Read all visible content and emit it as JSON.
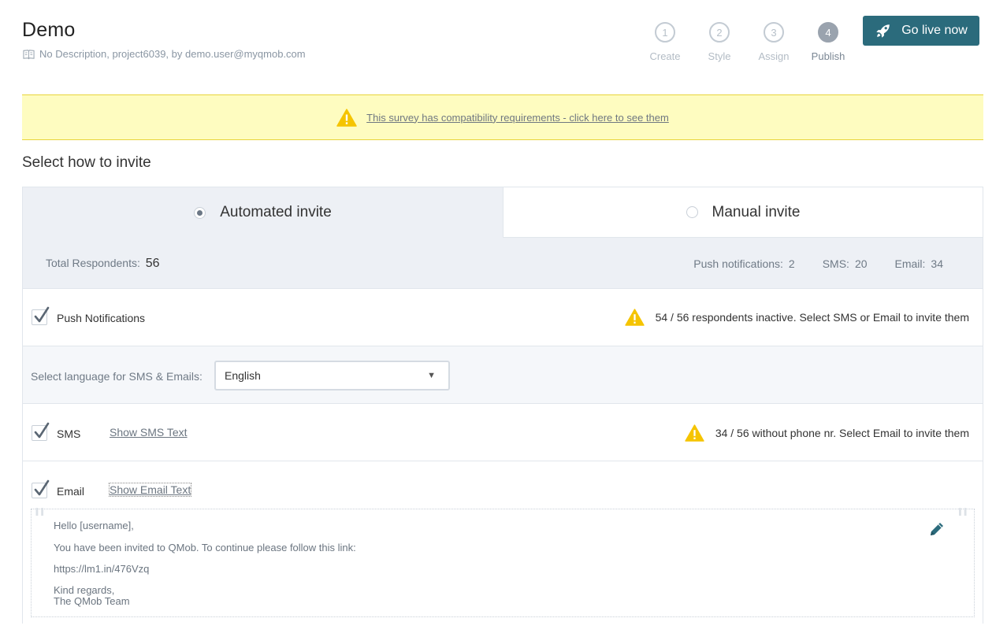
{
  "header": {
    "title": "Demo",
    "subtitle": "No Description, project6039, by demo.user@myqmob.com",
    "go_live_label": "Go live now"
  },
  "steps": [
    {
      "number": "1",
      "label": "Create",
      "active": false
    },
    {
      "number": "2",
      "label": "Style",
      "active": false
    },
    {
      "number": "3",
      "label": "Assign",
      "active": false
    },
    {
      "number": "4",
      "label": "Publish",
      "active": true
    }
  ],
  "banner": {
    "text": "This survey has compatibility requirements - click here to see them"
  },
  "section_title": "Select how to invite",
  "tabs": {
    "automated": "Automated invite",
    "manual": "Manual invite",
    "selected": "automated"
  },
  "stats": {
    "total_label": "Total Respondents:",
    "total_value": "56",
    "push_label": "Push notifications:",
    "push_value": "2",
    "sms_label": "SMS:",
    "sms_value": "20",
    "email_label": "Email:",
    "email_value": "34"
  },
  "push": {
    "label": "Push Notifications",
    "checked": true,
    "warning": "54 / 56 respondents inactive. Select SMS or Email to invite them"
  },
  "language": {
    "label": "Select language for SMS & Emails:",
    "selected": "English"
  },
  "sms": {
    "label": "SMS",
    "checked": true,
    "link": "Show SMS Text",
    "warning": "34 / 56 without phone nr. Select Email to invite them"
  },
  "email": {
    "label": "Email",
    "checked": true,
    "link": "Show Email Text",
    "lines": [
      "Hello [username],",
      "You have been invited to QMob. To continue please follow this link:",
      "https://lm1.in/476Vzq",
      "Kind regards,",
      "The QMob Team"
    ]
  },
  "colors": {
    "accent": "#2b6b7c",
    "warning_bg": "#fefcc0",
    "warning_icon": "#f5c400",
    "panel_bg": "#edf0f5"
  },
  "icons": {
    "subtitle": "book-icon",
    "go_live": "rocket-icon",
    "warning": "warning-triangle-icon",
    "edit": "pencil-icon"
  }
}
